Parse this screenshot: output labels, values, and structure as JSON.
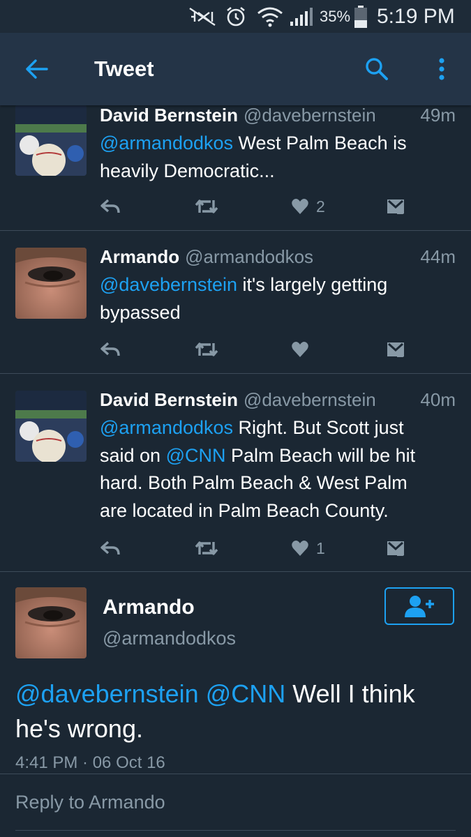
{
  "status_bar": {
    "battery": "35%",
    "clock": "5:19 PM",
    "icons": [
      "mute-icon",
      "alarm-icon",
      "wifi-icon",
      "signal-icon",
      "battery-icon"
    ]
  },
  "app_bar": {
    "title": "Tweet",
    "icons": [
      "back-arrow-icon",
      "search-icon",
      "more-vert-icon"
    ]
  },
  "colors": {
    "background": "#1b2733",
    "app_bar": "#243447",
    "accent": "#1da1f2",
    "secondary_text": "#8899a6",
    "divider": "#3d4b59"
  },
  "tweets": [
    {
      "name": "David Bernstein",
      "handle": "@davebernstein",
      "time": "49m",
      "lines": [
        {
          "mention": "@armandodkos",
          "text": " West Palm Beach is"
        },
        {
          "mention": "",
          "text": "heavily Democratic..."
        }
      ],
      "like_count": "2"
    },
    {
      "name": "Armando",
      "handle": "@armandodkos",
      "time": "44m",
      "lines": [
        {
          "mention": "@davebernstein",
          "text": " it's largely getting"
        },
        {
          "mention": "",
          "text": "bypassed"
        }
      ],
      "like_count": ""
    },
    {
      "name": "David Bernstein",
      "handle": "@davebernstein",
      "time": "40m",
      "lines": [
        {
          "mention": "@armandodkos",
          "text": " Right. But Scott just"
        },
        {
          "pre": "said on ",
          "mention": "@CNN",
          "text": " Palm Beach will be hit"
        },
        {
          "mention": "",
          "text": "hard. Both Palm Beach & West Palm"
        },
        {
          "mention": "",
          "text": "are located in Palm Beach County."
        }
      ],
      "like_count": "1"
    }
  ],
  "focused": {
    "name": "Armando",
    "handle": "@armandodkos",
    "mention1": "@davebernstein",
    "mention2": "@CNN",
    "text_line1": " Well I think",
    "text_line2": "he's wrong.",
    "timestamp": "4:41 PM · 06 Oct 16"
  },
  "reply": {
    "placeholder": "Reply to Armando"
  }
}
